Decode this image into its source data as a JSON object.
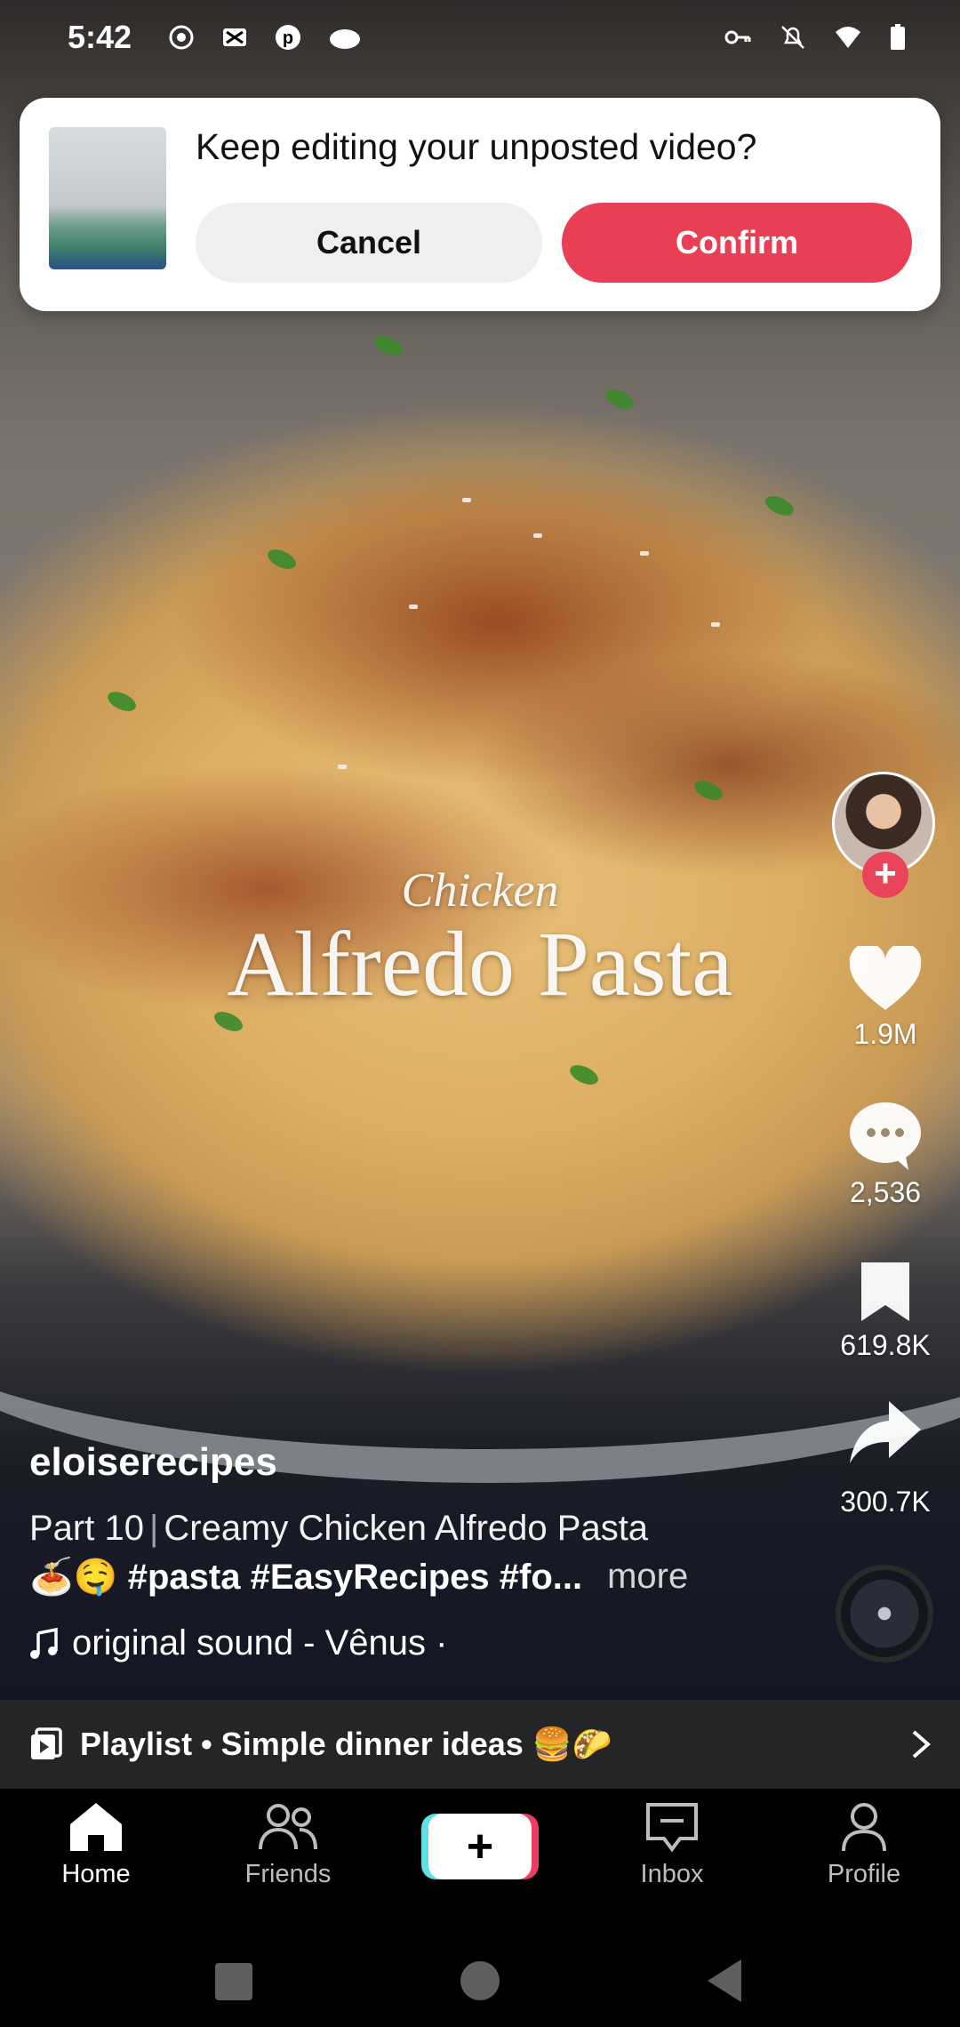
{
  "status_bar": {
    "time": "5:42",
    "left_icons": [
      "record-icon",
      "app-icon",
      "pinterest-icon",
      "cloud-icon"
    ],
    "right_icons": [
      "vpn-key-icon",
      "bell-off-icon",
      "wifi-icon",
      "battery-icon"
    ]
  },
  "dialog": {
    "title": "Keep editing your unposted video?",
    "cancel_label": "Cancel",
    "confirm_label": "Confirm",
    "colors": {
      "confirm": "#e83f55",
      "cancel": "#efefef"
    }
  },
  "video_overlay": {
    "line1": "Chicken",
    "line2": "Alfredo Pasta"
  },
  "actions": {
    "likes": "1.9M",
    "comments": "2,536",
    "saves": "619.8K",
    "shares": "300.7K"
  },
  "post": {
    "username": "eloiserecipes",
    "part": "Part 10",
    "title": "Creamy Chicken Alfredo Pasta",
    "hashtags": "🍝🤤 #pasta #EasyRecipes #fo...",
    "more": "more",
    "sound": "original sound - Vênus ·"
  },
  "playlist": {
    "label": "Playlist • Simple dinner ideas 🍔🌮"
  },
  "bottom_nav": {
    "home": "Home",
    "friends": "Friends",
    "create": "+",
    "inbox": "Inbox",
    "profile": "Profile"
  }
}
